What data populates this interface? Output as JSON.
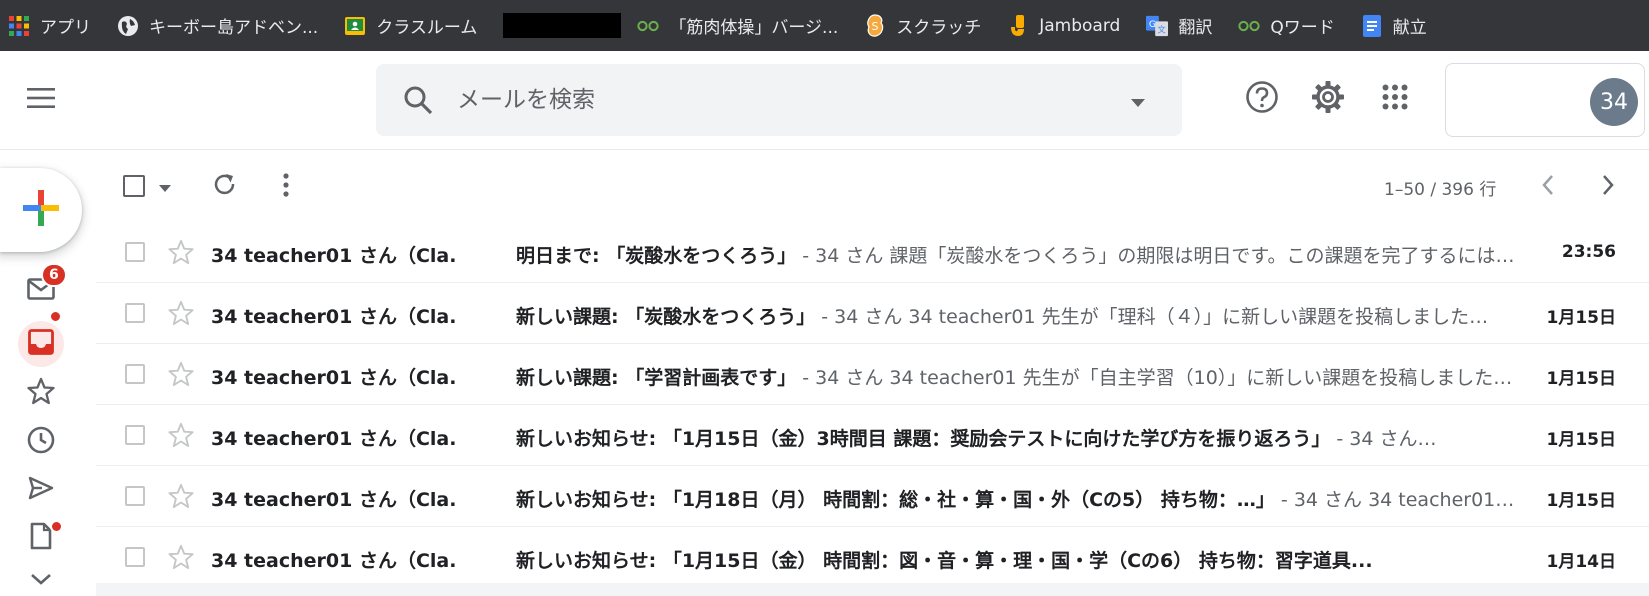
{
  "bookmarks": [
    {
      "label": "アプリ",
      "icon": "apps-grid-icon"
    },
    {
      "label": "キーボー島アドベン...",
      "icon": "globe-icon"
    },
    {
      "label": "クラスルーム",
      "icon": "classroom-icon"
    },
    {
      "label": "「筋肉体操」バージ...",
      "icon": "glasses-icon"
    },
    {
      "label": "スクラッチ",
      "icon": "scratch-icon"
    },
    {
      "label": "Jamboard",
      "icon": "jamboard-icon"
    },
    {
      "label": "翻訳",
      "icon": "translate-icon"
    },
    {
      "label": "Qワード",
      "icon": "glasses-icon"
    },
    {
      "label": "献立",
      "icon": "docs-icon"
    }
  ],
  "search": {
    "placeholder": "メールを検索"
  },
  "account": {
    "avatar_text": "34"
  },
  "nav": {
    "inbox_unread": "6"
  },
  "pagination": {
    "range": "1–50 / 396 行"
  },
  "emails": [
    {
      "sender": "34 teacher01 さん（Cla.",
      "subject": "明日まで: 「炭酸水をつくろう」",
      "snippet": " - 34 さん 課題「炭酸水をつくろう」の期限は明日です。この課題を完了するには…",
      "date": "23:56"
    },
    {
      "sender": "34 teacher01 さん（Cla.",
      "subject": "新しい課題: 「炭酸水をつくろう」",
      "snippet": " - 34 さん 34 teacher01 先生が「理科（４）」に新しい課題を投稿しました…",
      "date": "1月15日"
    },
    {
      "sender": "34 teacher01 さん（Cla.",
      "subject": "新しい課題: 「学習計画表です」",
      "snippet": " - 34 さん 34 teacher01 先生が「自主学習（10）」に新しい課題を投稿しました…",
      "date": "1月15日"
    },
    {
      "sender": "34 teacher01 さん（Cla.",
      "subject": "新しいお知らせ: 「1月15日（金）3時間目 課題：奨励会テストに向けた学び方を振り返ろう」",
      "snippet": " - 34 さん…",
      "date": "1月15日"
    },
    {
      "sender": "34 teacher01 さん（Cla.",
      "subject": "新しいお知らせ: 「1月18日（月） 時間割：総・社・算・国・外（Cの5） 持ち物：…」",
      "snippet": " - 34 さん 34 teacher01…",
      "date": "1月15日"
    },
    {
      "sender": "34 teacher01 さん（Cla.",
      "subject": "新しいお知らせ: 「1月15日（金） 時間割：図・音・算・理・国・学（Cの6） 持ち物：習字道具...",
      "snippet": "",
      "date": "1月14日"
    }
  ],
  "colors": {
    "bookmark_bar": "#35363a",
    "accent_red": "#d93025",
    "search_bg": "#f1f3f4"
  }
}
